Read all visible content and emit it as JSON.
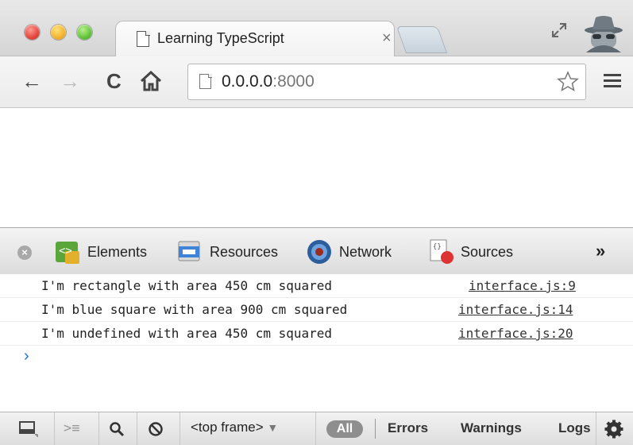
{
  "browser": {
    "tab_title": "Learning TypeScript",
    "tab_close": "×",
    "url_host": "0.0.0.0",
    "url_port": ":8000"
  },
  "devtools": {
    "tabs": [
      {
        "label": "Elements"
      },
      {
        "label": "Resources"
      },
      {
        "label": "Network"
      },
      {
        "label": "Sources"
      }
    ],
    "more": "»",
    "close": "×"
  },
  "console": {
    "lines": [
      {
        "message": "I'm rectangle with area 450 cm squared",
        "source": "interface.js:9"
      },
      {
        "message": "I'm blue square with area 900 cm squared",
        "source": "interface.js:14"
      },
      {
        "message": "I'm undefined with area 450 cm squared",
        "source": "interface.js:20"
      }
    ],
    "prompt": "›"
  },
  "statusbar": {
    "frame": "<top frame>",
    "frame_arrow": "▼",
    "filters": [
      "All",
      "Errors",
      "Warnings",
      "Logs"
    ]
  }
}
